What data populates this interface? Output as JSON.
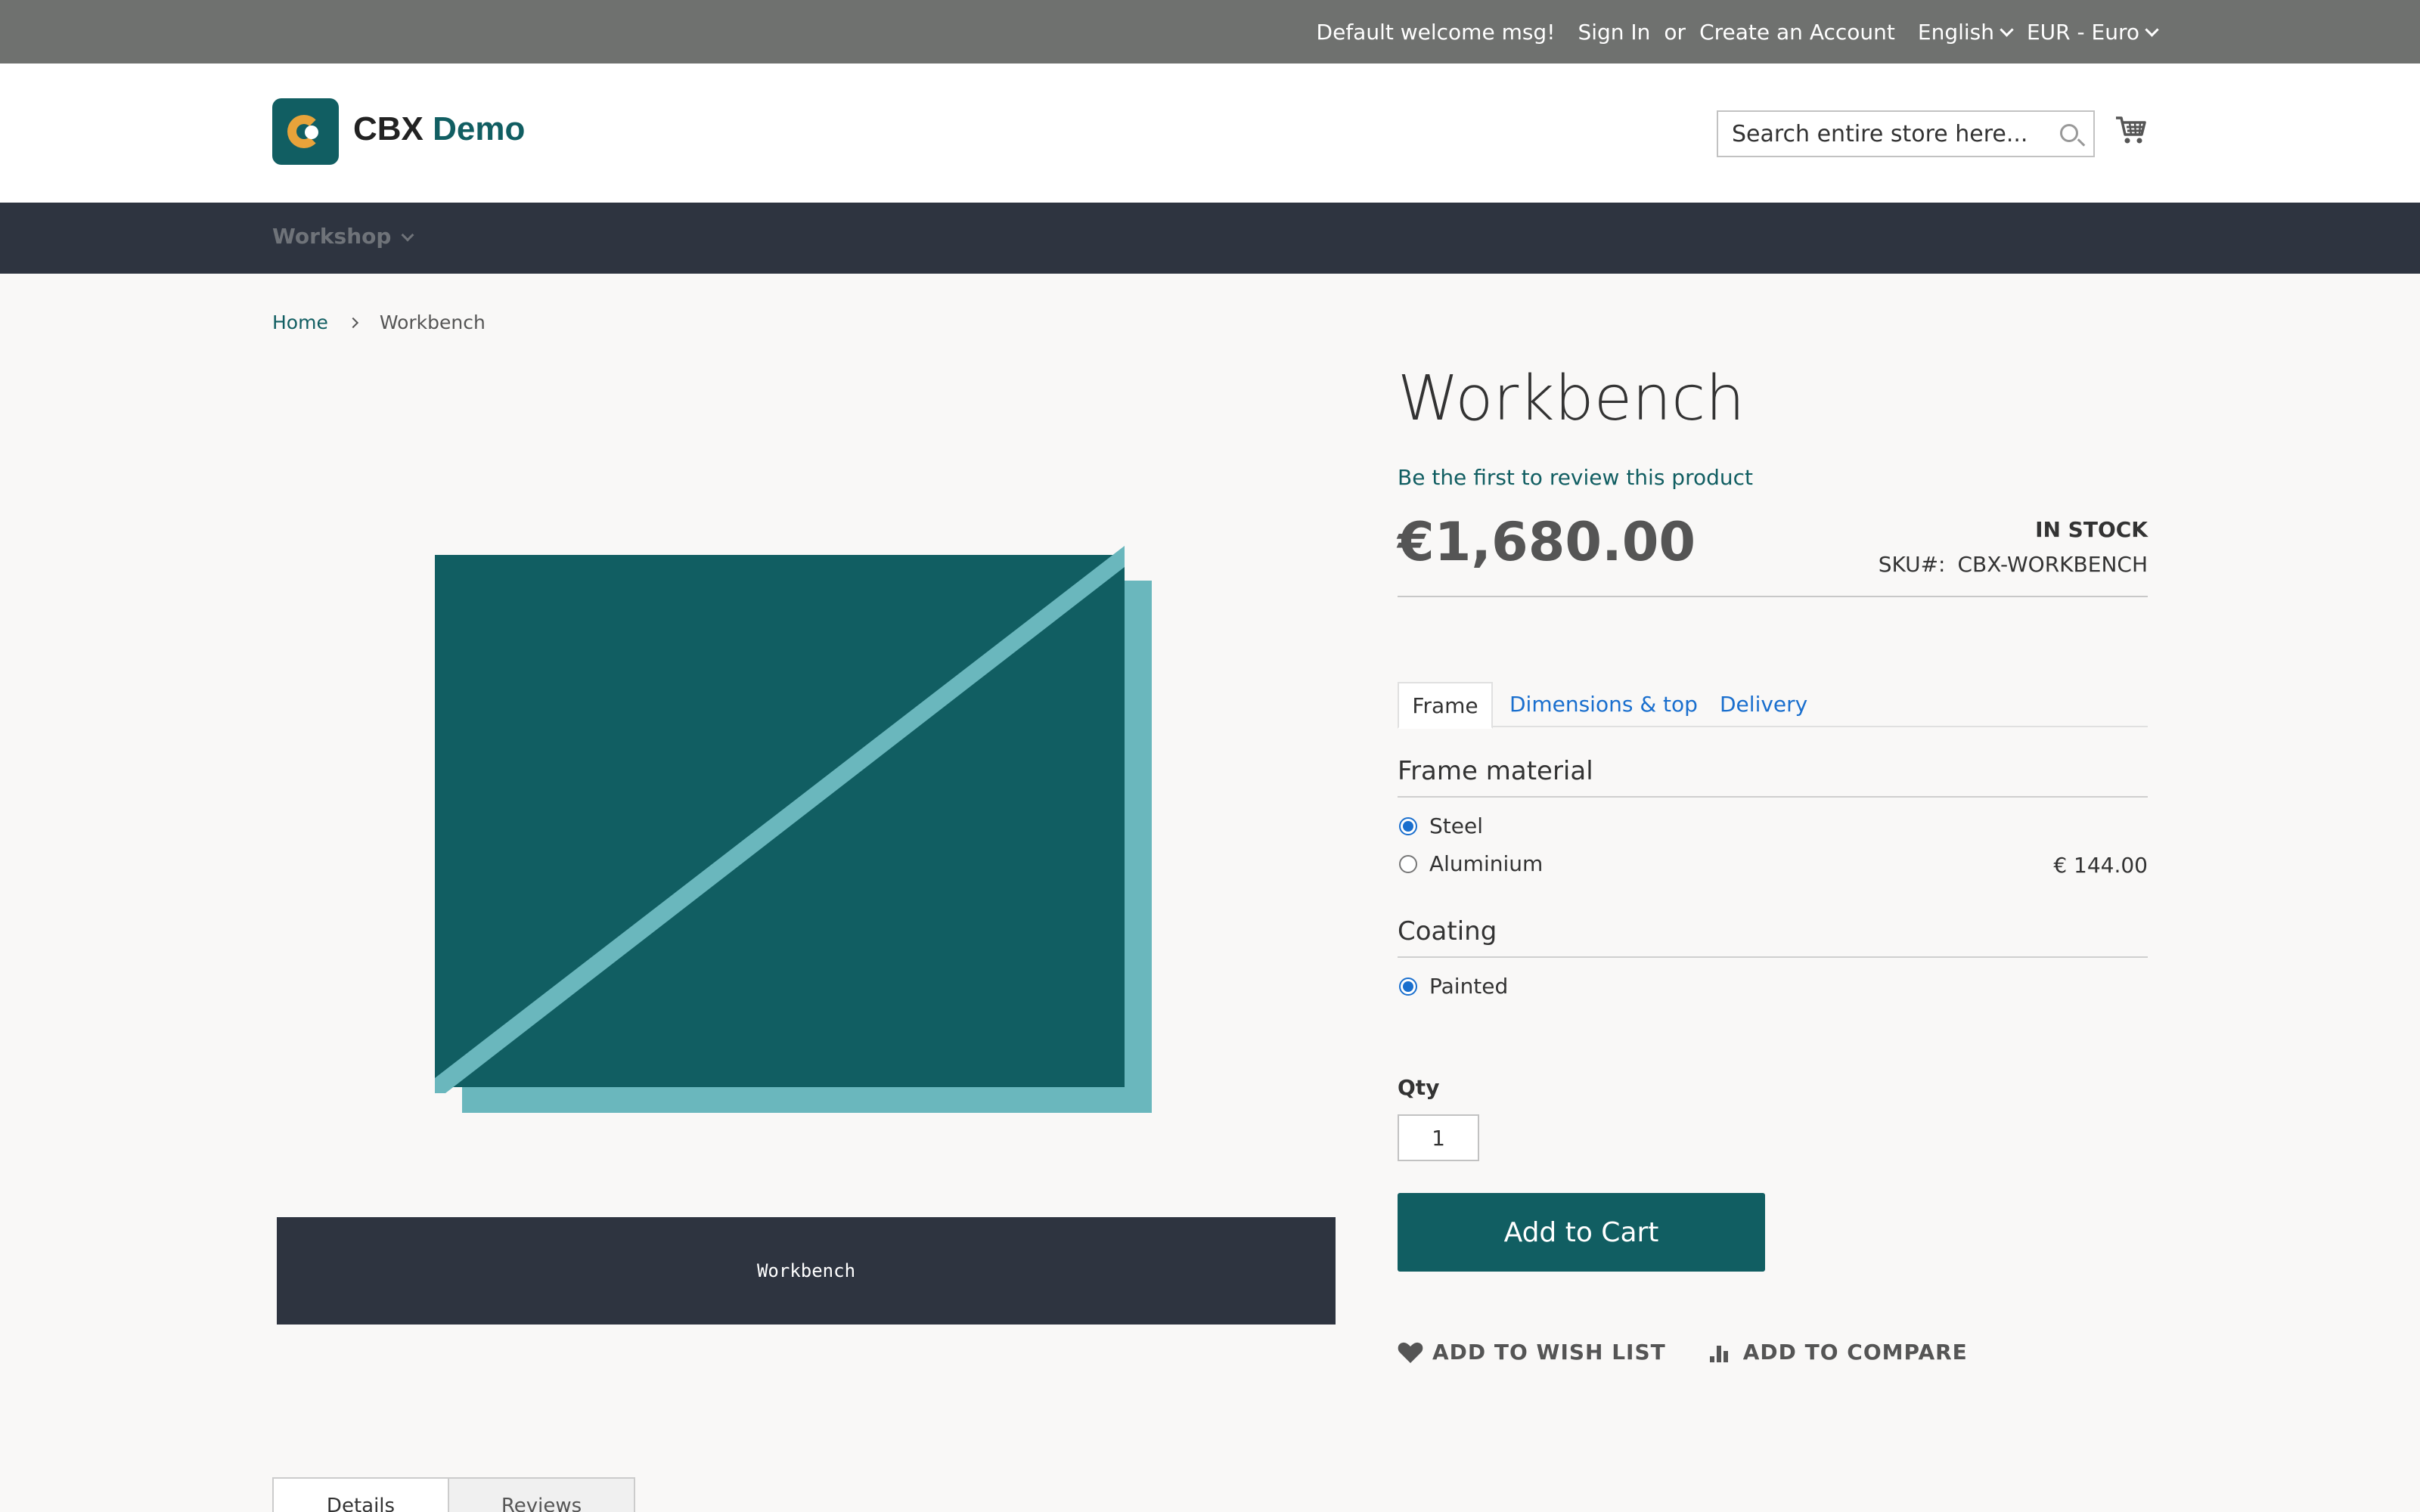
{
  "topbar": {
    "welcome": "Default welcome msg!",
    "sign_in": "Sign In",
    "or": "or",
    "create_account": "Create an Account",
    "language": "English",
    "currency": "EUR - Euro"
  },
  "header": {
    "logo_text_1": "CBX",
    "logo_text_2": "Demo",
    "search_placeholder": "Search entire store here...",
    "icons": {
      "search": "search-icon",
      "cart": "cart-icon"
    }
  },
  "nav": {
    "items": [
      {
        "label": "Workshop"
      }
    ]
  },
  "breadcrumb": {
    "home": "Home",
    "current": "Workbench"
  },
  "product": {
    "title": "Workbench",
    "review_link": "Be the first to review this product",
    "price": "€1,680.00",
    "stock": "IN STOCK",
    "sku_label": "SKU#:",
    "sku": "CBX-WORKBENCH",
    "image_caption": "Workbench"
  },
  "config_tabs": [
    {
      "label": "Frame",
      "active": true
    },
    {
      "label": "Dimensions & top"
    },
    {
      "label": "Delivery"
    }
  ],
  "frame_material": {
    "heading": "Frame material",
    "options": [
      {
        "label": "Steel",
        "selected": true,
        "price": ""
      },
      {
        "label": "Aluminium",
        "selected": false,
        "price": "€ 144.00"
      }
    ]
  },
  "coating": {
    "heading": "Coating",
    "options": [
      {
        "label": "Painted",
        "selected": true
      }
    ]
  },
  "qty": {
    "label": "Qty",
    "value": "1"
  },
  "buttons": {
    "add_to_cart": "Add to Cart",
    "wish_list": "ADD TO WISH LIST",
    "compare": "ADD TO COMPARE"
  },
  "bottom_tabs": [
    {
      "label": "Details"
    },
    {
      "label": "Reviews"
    }
  ],
  "colors": {
    "brand": "#115e62",
    "brand_light": "#6ab7bd",
    "nav_dark": "#2e3440",
    "topbar": "#6f716f",
    "link": "#1a6fce",
    "logo_accent": "#e8a33a"
  }
}
